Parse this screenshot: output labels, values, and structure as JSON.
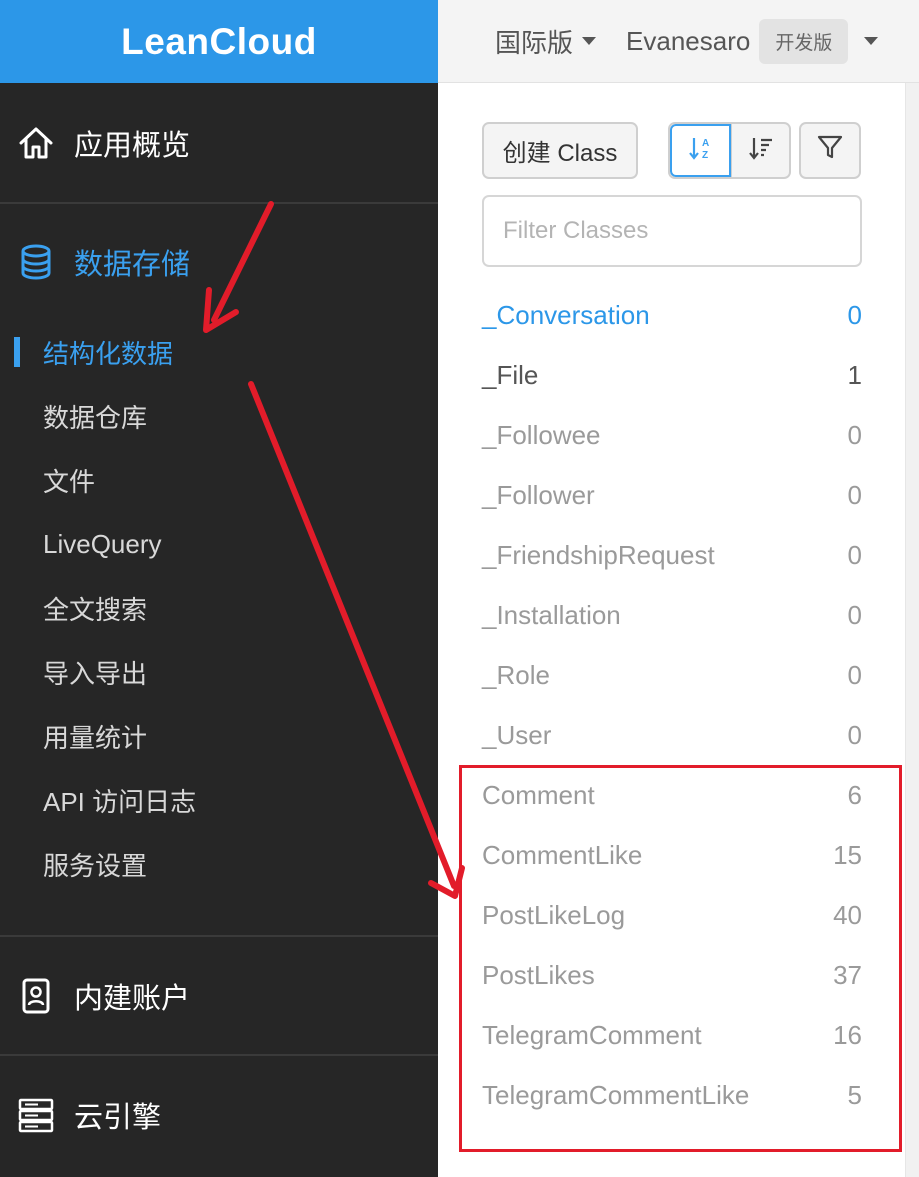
{
  "brand": "LeanCloud",
  "topbar": {
    "region": "国际版",
    "username": "Evanesaro",
    "plan_badge": "开发版"
  },
  "sidebar": {
    "overview": {
      "label": "应用概览",
      "icon": "home-icon"
    },
    "storage": {
      "label": "数据存储",
      "icon": "database-icon",
      "items": [
        {
          "label": "结构化数据",
          "active": true
        },
        {
          "label": "数据仓库"
        },
        {
          "label": "文件"
        },
        {
          "label": "LiveQuery"
        },
        {
          "label": "全文搜索"
        },
        {
          "label": "导入导出"
        },
        {
          "label": "用量统计"
        },
        {
          "label": "API 访问日志"
        },
        {
          "label": "服务设置"
        }
      ]
    },
    "accounts": {
      "label": "内建账户",
      "icon": "id-card-icon"
    },
    "engine": {
      "label": "云引擎",
      "icon": "server-icon"
    }
  },
  "panel": {
    "create_label": "创建 Class",
    "sort_alpha_icon": "sort-alpha-icon",
    "sort_count_icon": "sort-count-icon",
    "filter_icon": "filter-icon",
    "search_placeholder": "Filter Classes",
    "classes": [
      {
        "name": "_Conversation",
        "count": "0"
      },
      {
        "name": "_File",
        "count": "1"
      },
      {
        "name": "_Followee",
        "count": "0"
      },
      {
        "name": "_Follower",
        "count": "0"
      },
      {
        "name": "_FriendshipRequest",
        "count": "0"
      },
      {
        "name": "_Installation",
        "count": "0"
      },
      {
        "name": "_Role",
        "count": "0"
      },
      {
        "name": "_User",
        "count": "0"
      },
      {
        "name": "Comment",
        "count": "6"
      },
      {
        "name": "CommentLike",
        "count": "15"
      },
      {
        "name": "PostLikeLog",
        "count": "40"
      },
      {
        "name": "PostLikes",
        "count": "37"
      },
      {
        "name": "TelegramComment",
        "count": "16"
      },
      {
        "name": "TelegramCommentLike",
        "count": "5"
      }
    ]
  },
  "colors": {
    "accent": "#2c97e8",
    "sidebar_bg": "#262626",
    "annotation_red": "#e21c2a"
  }
}
